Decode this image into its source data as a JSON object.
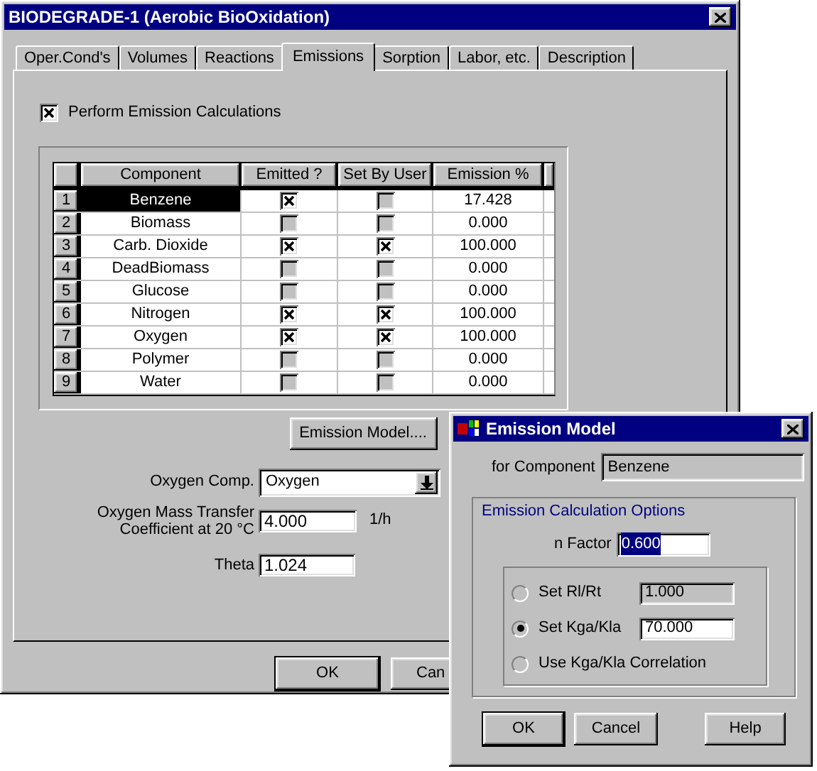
{
  "window": {
    "title": "BIODEGRADE-1 (Aerobic BioOxidation)"
  },
  "tabs": [
    {
      "label": "Oper.Cond's",
      "selected": false
    },
    {
      "label": "Volumes",
      "selected": false
    },
    {
      "label": "Reactions",
      "selected": false
    },
    {
      "label": "Emissions",
      "selected": true
    },
    {
      "label": "Sorption",
      "selected": false
    },
    {
      "label": "Labor, etc.",
      "selected": false
    },
    {
      "label": "Description",
      "selected": false
    }
  ],
  "perform_emission": {
    "label": "Perform Emission Calculations",
    "checked": true
  },
  "table": {
    "columns": [
      "Component",
      "Emitted ?",
      "Set By User",
      "Emission %"
    ],
    "rows": [
      {
        "index": "1",
        "component": "Benzene",
        "emitted": true,
        "set_by_user": false,
        "emission": "17.428",
        "selected": true
      },
      {
        "index": "2",
        "component": "Biomass",
        "emitted": false,
        "set_by_user": false,
        "emission": "0.000",
        "selected": false
      },
      {
        "index": "3",
        "component": "Carb. Dioxide",
        "emitted": true,
        "set_by_user": true,
        "emission": "100.000",
        "selected": false
      },
      {
        "index": "4",
        "component": "DeadBiomass",
        "emitted": false,
        "set_by_user": false,
        "emission": "0.000",
        "selected": false
      },
      {
        "index": "5",
        "component": "Glucose",
        "emitted": false,
        "set_by_user": false,
        "emission": "0.000",
        "selected": false
      },
      {
        "index": "6",
        "component": "Nitrogen",
        "emitted": true,
        "set_by_user": true,
        "emission": "100.000",
        "selected": false
      },
      {
        "index": "7",
        "component": "Oxygen",
        "emitted": true,
        "set_by_user": true,
        "emission": "100.000",
        "selected": false
      },
      {
        "index": "8",
        "component": "Polymer",
        "emitted": false,
        "set_by_user": false,
        "emission": "0.000",
        "selected": false
      },
      {
        "index": "9",
        "component": "Water",
        "emitted": false,
        "set_by_user": false,
        "emission": "0.000",
        "selected": false
      }
    ]
  },
  "emission_model_button": "Emission Model....",
  "oxygen_comp": {
    "label": "Oxygen Comp.",
    "value": "Oxygen"
  },
  "mass_transfer": {
    "label": "Oxygen Mass Transfer\nCoefficient at 20 °C",
    "value": "4.000",
    "unit": "1/h"
  },
  "theta": {
    "label": "Theta",
    "value": "1.024"
  },
  "buttons": [
    "OK",
    "Can"
  ],
  "dialog": {
    "title": "Emission Model",
    "for_component": {
      "label": "for Component",
      "value": "Benzene"
    },
    "group_title": "Emission Calculation Options",
    "n_factor": {
      "label": "n Factor",
      "value": "0.600"
    },
    "options": [
      {
        "label": "Set Rl/Rt",
        "selected": false,
        "value": "1.000",
        "disabled": true
      },
      {
        "label": "Set Kga/Kla",
        "selected": true,
        "value": "70.000",
        "disabled": false
      },
      {
        "label": "Use Kga/Kla Correlation",
        "selected": false,
        "disabled": false
      }
    ],
    "buttons": [
      "OK",
      "Cancel",
      "Help"
    ]
  }
}
